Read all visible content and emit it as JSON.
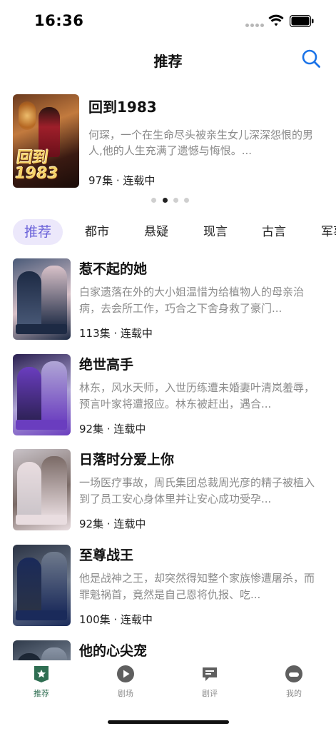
{
  "status": {
    "time": "16:36"
  },
  "nav": {
    "title": "推荐"
  },
  "banner": {
    "title": "回到1983",
    "poster_text": "回到1983",
    "description": "何琛，一个在生命尽头被亲生女儿深深怨恨的男人,他的人生充满了遗憾与悔恨。...",
    "meta": "97集 · 连载中",
    "pager": {
      "count": 4,
      "active_index": 1
    }
  },
  "categories": [
    "推荐",
    "都市",
    "悬疑",
    "现言",
    "古言",
    "军事"
  ],
  "items": [
    {
      "title": "惹不起的她",
      "description": "白家遗落在外的大小姐温惜为给植物人的母亲治病，去会所工作，巧合之下舍身救了豪门...",
      "meta": "113集 · 连载中",
      "colors": [
        "#4a5a78",
        "#d9c2c9",
        "#1d2a44"
      ]
    },
    {
      "title": "绝世高手",
      "description": "林东，风水天师，入世历练遭未婚妻叶清岚羞辱，预言叶家将遭报应。林东被赶出，遇合...",
      "meta": "92集 · 连载中",
      "colors": [
        "#2a2050",
        "#b0a6d6",
        "#6a3dbf"
      ]
    },
    {
      "title": "日落时分爱上你",
      "description": "一场医疗事故，周氏集团总裁周光彦的精子被植入到了员工安心身体里并让安心成功受孕...",
      "meta": "92集 · 连载中",
      "colors": [
        "#c9c3c8",
        "#7a6a66",
        "#e9dde0"
      ]
    },
    {
      "title": "至尊战王",
      "description": "他是战神之王，却突然得知整个家族惨遭屠杀，而罪魁祸首，竟然是自己恩将仇报、吃...",
      "meta": "100集 · 连载中",
      "colors": [
        "#2b3344",
        "#6f7a8c",
        "#1a2a5a"
      ]
    },
    {
      "title": "他的心尖宠",
      "description": "",
      "meta": "",
      "colors": [
        "#2f3a4a",
        "#8a95a6",
        "#1b2533"
      ]
    }
  ],
  "tabbar": {
    "tabs": [
      {
        "label": "推荐",
        "icon": "recommend-icon",
        "active": true
      },
      {
        "label": "剧场",
        "icon": "play-icon",
        "active": false
      },
      {
        "label": "剧评",
        "icon": "comment-icon",
        "active": false
      },
      {
        "label": "我的",
        "icon": "profile-icon",
        "active": false
      }
    ],
    "accent": "#2f6e52"
  },
  "colors": {
    "accent": "#1a73e8",
    "category_active_bg": "#ece8fb",
    "category_active_text": "#6b63d9"
  }
}
